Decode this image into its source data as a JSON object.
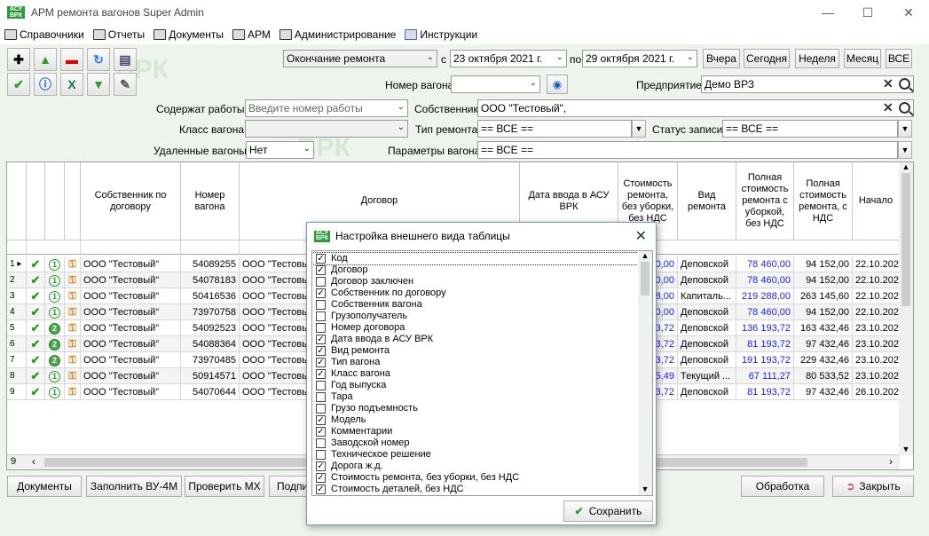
{
  "window": {
    "title": "АРМ ремонта вагонов Super Admin",
    "logo_text": "АСУ ВРК",
    "minimize_icon": "minimize-icon",
    "maximize_icon": "maximize-icon",
    "close_icon": "close-icon"
  },
  "menu": [
    {
      "label": "Справочники",
      "icon": "books-icon"
    },
    {
      "label": "Отчеты",
      "icon": "reports-icon"
    },
    {
      "label": "Документы",
      "icon": "documents-icon"
    },
    {
      "label": "АРМ",
      "icon": "arm-icon"
    },
    {
      "label": "Администрирование",
      "icon": "admin-icon"
    },
    {
      "label": "Инструкции",
      "icon": "help-icon"
    }
  ],
  "filters": {
    "date_type": "Окончание ремонта",
    "from_label": "с",
    "date_from": "23 октября  2021 г.",
    "to_label": "по",
    "date_to": "29 октября  2021 г.",
    "quick_buttons": [
      "Вчера",
      "Сегодня",
      "Неделя",
      "Месяц",
      "ВСЕ"
    ],
    "wagon_no_label": "Номер вагона",
    "wagon_no_value": "",
    "enterprise_label": "Предприятие",
    "enterprise_value": "Демо ВРЗ",
    "works_label": "Содержат работы",
    "works_placeholder": "Введите номер работы",
    "owner_label": "Собственник",
    "owner_value": "ООО \"Тестовый\",",
    "wagon_class_label": "Класс вагона",
    "wagon_class_value": "",
    "repair_type_label": "Тип ремонта",
    "repair_type_value": "== ВСЕ ==",
    "record_status_label": "Статус записи",
    "record_status_value": "== ВСЕ ==",
    "deleted_label": "Удаленные вагоны",
    "deleted_value": "Нет",
    "params_label": "Параметры вагона",
    "params_value": "== ВСЕ =="
  },
  "table": {
    "headers": [
      "Собственник по договору",
      "Номер вагона",
      "Договор",
      "Дата ввода в АСУ ВРК",
      "Стоимость ремонта, без уборки, без НДС",
      "Вид ремонта",
      "Полная стоимость ремонта с уборкой, без НДС",
      "Полная стоимость ремонта, с НДС",
      "Начало"
    ],
    "rows": [
      {
        "n": "1",
        "owner": "ООО \"Тестовый\"",
        "wagon": "54089255",
        "contract": "ООО \"Тестовы",
        "cost": "0,00",
        "kind": "Деповской",
        "full": "78 460,00",
        "vat": "94 152,00",
        "start": "22.10.202",
        "st": "1"
      },
      {
        "n": "2",
        "owner": "ООО \"Тестовый\"",
        "wagon": "54078183",
        "contract": "ООО \"Тестовы",
        "cost": "0,00",
        "kind": "Деповской",
        "full": "78 460,00",
        "vat": "94 152,00",
        "start": "22.10.202",
        "st": "1"
      },
      {
        "n": "3",
        "owner": "ООО \"Тестовый\"",
        "wagon": "50416536",
        "contract": "ООО \"Тестовы",
        "cost": "8,00",
        "kind": "Капиталь...",
        "full": "219 288,00",
        "vat": "263 145,60",
        "start": "22.10.202",
        "st": "1"
      },
      {
        "n": "4",
        "owner": "ООО \"Тестовый\"",
        "wagon": "73970758",
        "contract": "ООО \"Тестовы",
        "cost": "0,00",
        "kind": "Деповской",
        "full": "78 460,00",
        "vat": "94 152,00",
        "start": "22.10.202",
        "st": "1"
      },
      {
        "n": "5",
        "owner": "ООО \"Тестовый\"",
        "wagon": "54092523",
        "contract": "ООО \"Тестовы",
        "cost": "3,72",
        "kind": "Деповской",
        "full": "136 193,72",
        "vat": "163 432,46",
        "start": "23.10.202",
        "st": "2"
      },
      {
        "n": "6",
        "owner": "ООО \"Тестовый\"",
        "wagon": "54088364",
        "contract": "ООО \"Тестовы",
        "cost": "3,72",
        "kind": "Деповской",
        "full": "81 193,72",
        "vat": "97 432,46",
        "start": "23.10.202",
        "st": "2"
      },
      {
        "n": "7",
        "owner": "ООО \"Тестовый\"",
        "wagon": "73970485",
        "contract": "ООО \"Тестовы",
        "cost": "3,72",
        "kind": "Деповской",
        "full": "191 193,72",
        "vat": "229 432,46",
        "start": "23.10.202",
        "st": "2"
      },
      {
        "n": "8",
        "owner": "ООО \"Тестовый\"",
        "wagon": "50914571",
        "contract": "ООО \"Тестовы",
        "cost": "5,49",
        "kind": "Текущий ...",
        "full": "67 111,27",
        "vat": "80 533,52",
        "start": "23.10.202",
        "st": "1"
      },
      {
        "n": "9",
        "owner": "ООО \"Тестовый\"",
        "wagon": "54070644",
        "contract": "ООО \"Тестовы",
        "cost": "3,72",
        "kind": "Деповской",
        "full": "81 193,72",
        "vat": "97 432,46",
        "start": "26.10.202",
        "st": "1"
      }
    ],
    "row_count": "9"
  },
  "bottom_buttons": [
    "Документы",
    "Заполнить ВУ-4М",
    "Проверить МХ",
    "Подпи",
    "Обработка",
    "Закрыть"
  ],
  "dialog": {
    "title": "Настройка внешнего вида таблицы",
    "save": "Сохранить",
    "items": [
      {
        "label": "Код",
        "checked": true
      },
      {
        "label": "Договор",
        "checked": true
      },
      {
        "label": "Договор заключен",
        "checked": false
      },
      {
        "label": "Собственник по договору",
        "checked": true
      },
      {
        "label": "Собственник вагона",
        "checked": false
      },
      {
        "label": "Грузополучатель",
        "checked": false
      },
      {
        "label": "Номер договора",
        "checked": false
      },
      {
        "label": "Дата ввода в АСУ ВРК",
        "checked": true
      },
      {
        "label": "Вид ремонта",
        "checked": true
      },
      {
        "label": "Тип вагона",
        "checked": true
      },
      {
        "label": "Класс вагона",
        "checked": true
      },
      {
        "label": "Год выпуска",
        "checked": false
      },
      {
        "label": "Тара",
        "checked": false
      },
      {
        "label": "Грузо подъемность",
        "checked": false
      },
      {
        "label": "Модель",
        "checked": true
      },
      {
        "label": "Комментарии",
        "checked": true
      },
      {
        "label": "Заводской номер",
        "checked": false
      },
      {
        "label": "Техническое решение",
        "checked": false
      },
      {
        "label": "Дорога ж.д.",
        "checked": true
      },
      {
        "label": "Стоимость ремонта, без уборки, без НДС",
        "checked": true
      },
      {
        "label": "Стоимость деталей, без НДС",
        "checked": true
      }
    ]
  }
}
